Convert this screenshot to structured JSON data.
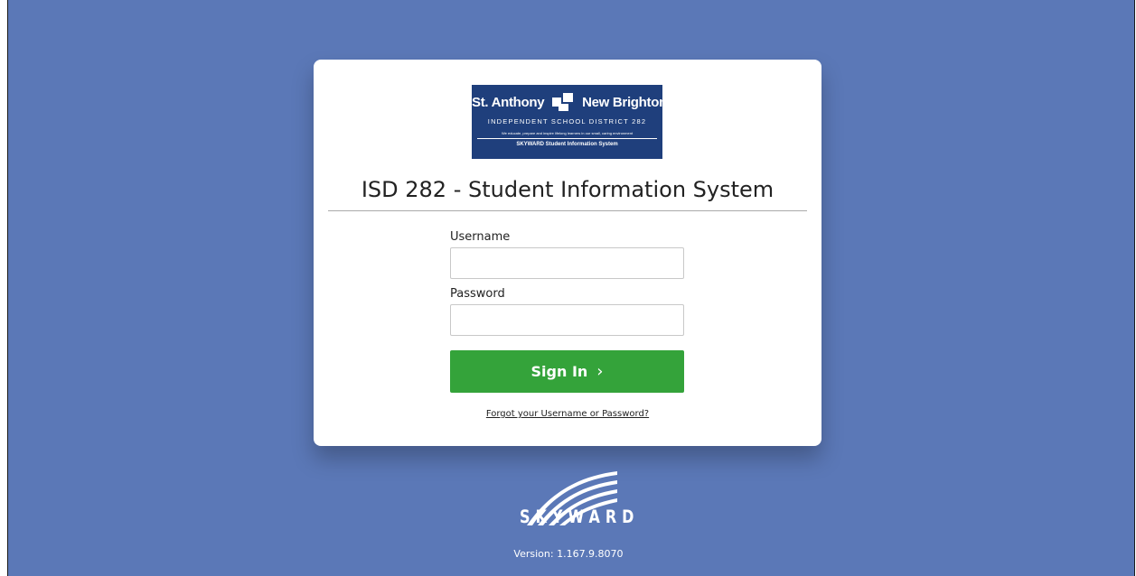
{
  "logo": {
    "line_left": "St. Anthony",
    "line_right": "New Brighton",
    "district": "INDEPENDENT SCHOOL DISTRICT 282",
    "mission": "We educate, prepare and inspire lifelong learners in our small, caring environment",
    "system": "SKYWARD Student Information System"
  },
  "title": "ISD 282 - Student Information System",
  "form": {
    "username_label": "Username",
    "username_value": "",
    "password_label": "Password",
    "password_value": "",
    "signin_label": "Sign In",
    "signin_chevron": "›",
    "forgot_link": "Forgot your Username or Password?"
  },
  "footer": {
    "brand": "SKYWARD",
    "version": "Version: 1.167.9.8070"
  },
  "colors": {
    "background": "#5b78b7",
    "button": "#34a33a",
    "logo_bg": "#1f3f7c"
  }
}
